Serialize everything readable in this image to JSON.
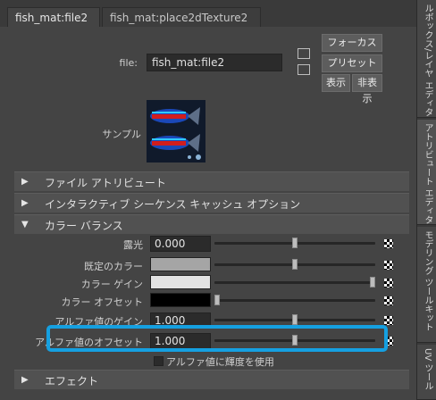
{
  "tabs": [
    {
      "label": "fish_mat:file2",
      "active": true
    },
    {
      "label": "fish_mat:place2dTexture2",
      "active": false
    }
  ],
  "file_row": {
    "label": "file:",
    "value": "fish_mat:file2",
    "focus_button": "フォーカス",
    "preset_button": "プリセット",
    "show_button": "表示",
    "hide_button": "非表示",
    "icons": [
      "input-connection-icon",
      "output-connection-icon"
    ]
  },
  "sample": {
    "label": "サンプル"
  },
  "sections": {
    "file_attributes": "ファイル アトリビュート",
    "interactive_sequence": "インタラクティブ シーケンス キャッシュ オプション",
    "color_balance": "カラー バランス",
    "effects": "エフェクト"
  },
  "color_balance_rows": [
    {
      "label": "露光",
      "value": "0.000",
      "slider": 0.5
    },
    {
      "label": "既定のカラー",
      "color": "#a5a5a5",
      "slider": 0.5
    },
    {
      "label": "カラー ゲイン",
      "color": "#e2e2e2",
      "slider": 1.0
    },
    {
      "label": "カラー オフセット",
      "color": "#000000",
      "slider": 0.0
    },
    {
      "label": "アルファ値のゲイン",
      "value": "1.000",
      "slider": 0.5
    },
    {
      "label": "アルファ値のオフセット",
      "value": "1.000",
      "slider": 0.5
    }
  ],
  "alpha_luminance_checkbox": {
    "label": "アルファ値に輝度を使用",
    "checked": false
  },
  "right_tabs": [
    "ルボックス/レイヤ エディタ",
    "アトリビュート エディタ",
    "モデリング ツールキット",
    "UV ツール"
  ],
  "highlight_color": "#15a0e1"
}
